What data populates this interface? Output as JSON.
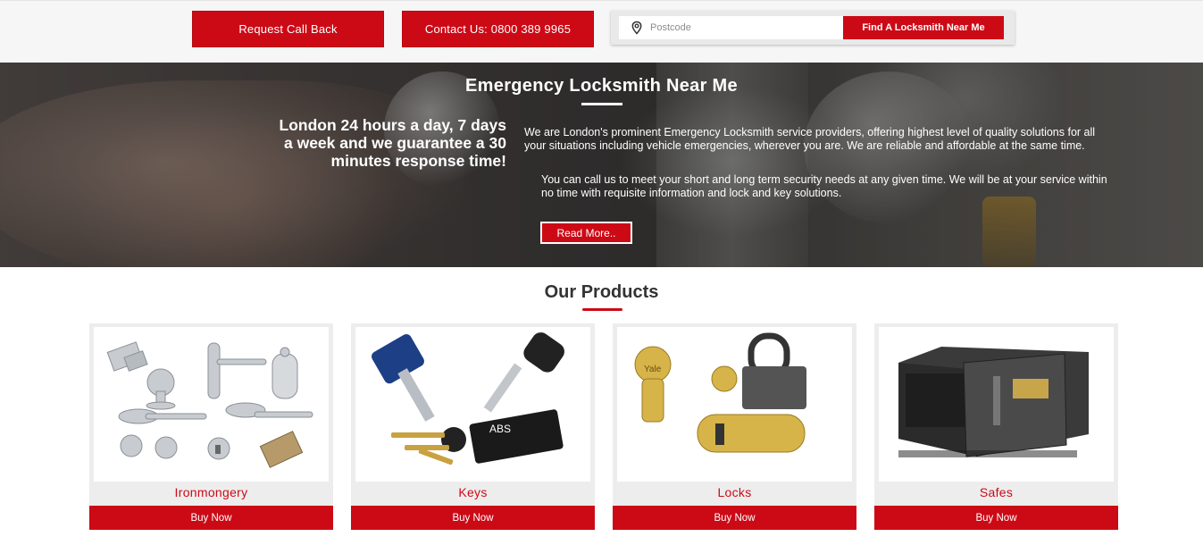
{
  "header": {
    "callback_label": "Request Call Back",
    "contact_label": "Contact Us: 0800 389 9965",
    "search": {
      "placeholder": "Postcode",
      "value": "",
      "button_label": "Find A Locksmith Near Me"
    }
  },
  "hero": {
    "title": "Emergency Locksmith Near Me",
    "tagline": "London 24 hours a day, 7 days a week and we guarantee a 30 minutes response time!",
    "paragraph1": "We are London's prominent Emergency Locksmith service providers, offering highest level of quality solutions for all your situations including vehicle emergencies, wherever you are. We are reliable and affordable at the same time.",
    "paragraph2": "You can call us to meet your short and long term security needs at any given time. We will be at your service within no time with requisite information and lock and key solutions.",
    "readmore_label": "Read More.."
  },
  "products": {
    "title": "Our Products",
    "items": [
      {
        "name": "Ironmongery",
        "button": "Buy Now",
        "icon": "ironmongery-image"
      },
      {
        "name": "Keys",
        "button": "Buy Now",
        "icon": "keys-image"
      },
      {
        "name": "Locks",
        "button": "Buy Now",
        "icon": "locks-image"
      },
      {
        "name": "Safes",
        "button": "Buy Now",
        "icon": "safes-image"
      }
    ]
  },
  "colors": {
    "accent": "#cc0a16",
    "heading": "#333333",
    "card_bg": "#ededed"
  }
}
